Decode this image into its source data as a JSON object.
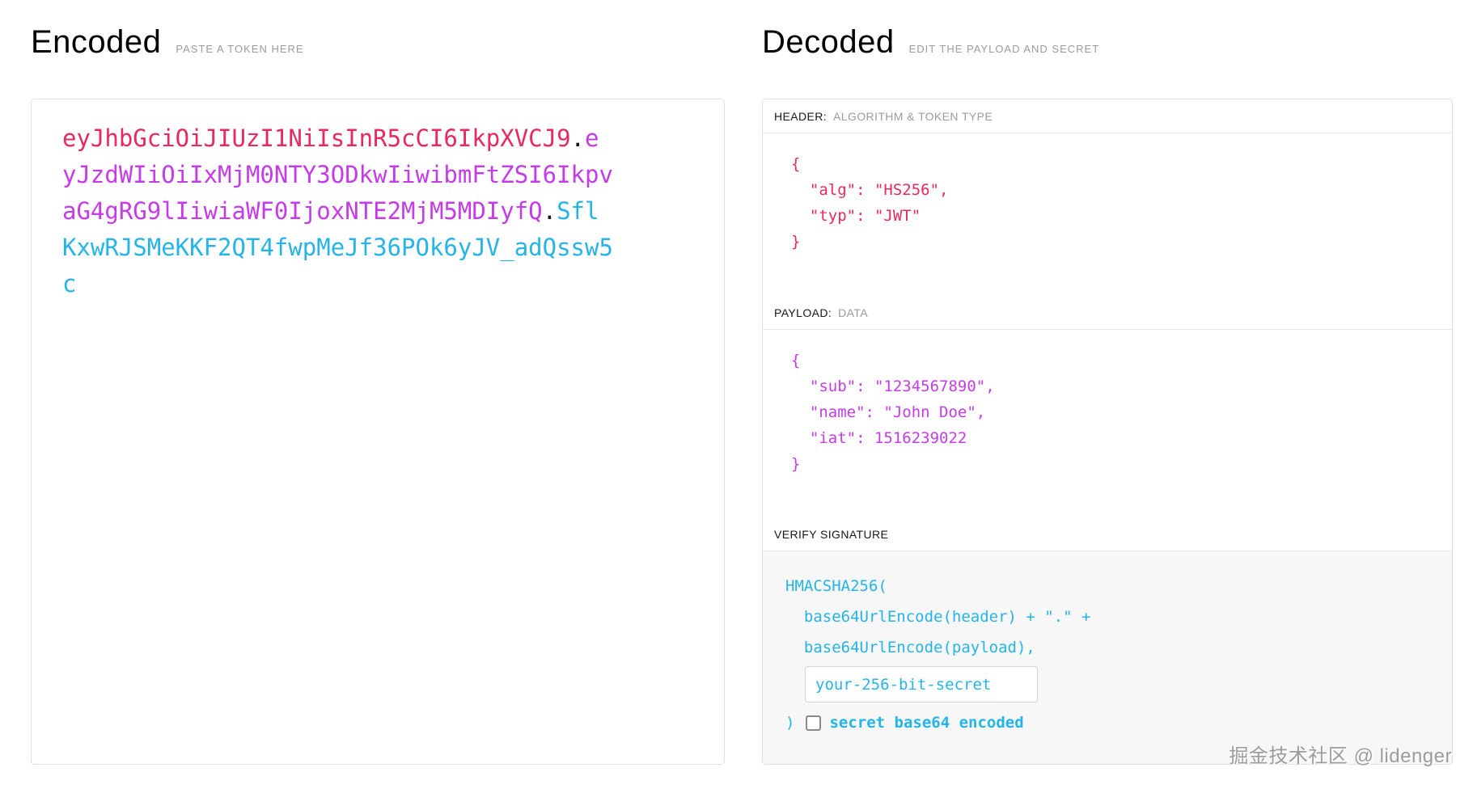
{
  "encoded": {
    "title": "Encoded",
    "subtitle": "PASTE A TOKEN HERE",
    "token": {
      "header": "eyJhbGciOiJIUzI1NiIsInR5cCI6IkpXVCJ9",
      "separator": ".",
      "payload": "eyJzdWIiOiIxMjM0NTY3ODkwIiwibmFtZSI6IkpvaG4gRG9lIiwiaWF0IjoxNTE2MjM5MDIyfQ",
      "signature": "SflKxwRJSMeKKF2QT4fwpMeJf36POk6yJV_adQssw5c"
    }
  },
  "decoded": {
    "title": "Decoded",
    "subtitle": "EDIT THE PAYLOAD AND SECRET",
    "header_section": {
      "label": "HEADER:",
      "sublabel": "ALGORITHM & TOKEN TYPE",
      "json": "{\n  \"alg\": \"HS256\",\n  \"typ\": \"JWT\"\n}"
    },
    "payload_section": {
      "label": "PAYLOAD:",
      "sublabel": "DATA",
      "json": "{\n  \"sub\": \"1234567890\",\n  \"name\": \"John Doe\",\n  \"iat\": 1516239022\n}"
    },
    "signature_section": {
      "label": "VERIFY SIGNATURE",
      "code_lines": "HMACSHA256(\n  base64UrlEncode(header) + \".\" +\n  base64UrlEncode(payload),",
      "secret_value": "your-256-bit-secret",
      "closing_paren": ")",
      "checkbox_checked": false,
      "checkbox_label": "secret base64 encoded"
    }
  },
  "watermark": "掘金技术社区 @ lidenger",
  "colors": {
    "header_color": "#e7295f",
    "payload_color": "#c63be8",
    "signature_color": "#25b4e8"
  }
}
